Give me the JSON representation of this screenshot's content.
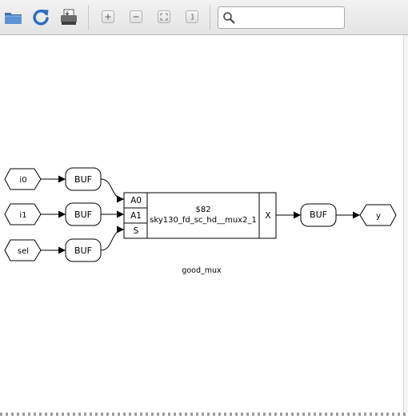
{
  "toolbar": {
    "open_icon": "folder-icon",
    "refresh_icon": "refresh-icon",
    "print_icon": "print-icon",
    "zoom_in_icon": "zoom-in-icon",
    "zoom_out_icon": "zoom-out-icon",
    "zoom_fit_icon": "zoom-fit-icon",
    "zoom_reset_icon": "zoom-reset-icon",
    "search_placeholder": "",
    "search_icon": "search-icon"
  },
  "schematic": {
    "module_name": "good_mux",
    "inputs": [
      "i0",
      "i1",
      "sel"
    ],
    "input_buffers": [
      "BUF",
      "BUF",
      "BUF"
    ],
    "cell": {
      "id": "$82",
      "type": "sky130_fd_sc_hd__mux2_1",
      "pins_in": [
        "A0",
        "A1",
        "S"
      ],
      "pin_out": "X"
    },
    "output_buffer": "BUF",
    "output": "y"
  },
  "colors": {
    "toolbar_bg": "#e8e8e8",
    "folder": "#4a7fbf",
    "refresh": "#2f6fc1",
    "stroke": "#000000"
  }
}
